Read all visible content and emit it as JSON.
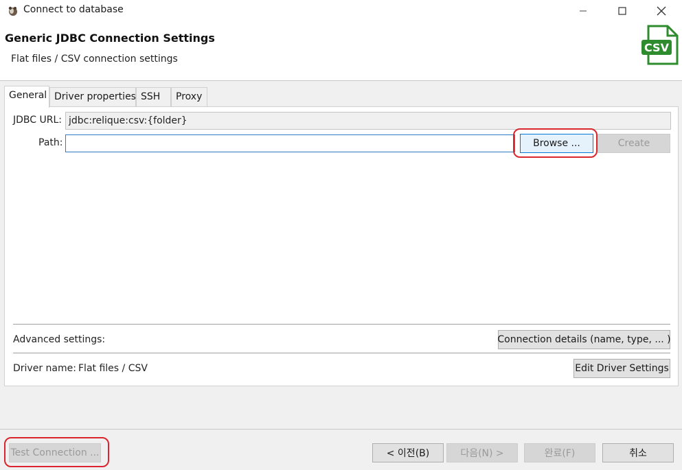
{
  "window": {
    "title": "Connect to database",
    "minimize_icon": "minimize-icon",
    "maximize_icon": "maximize-icon",
    "close_icon": "close-icon"
  },
  "header": {
    "title": "Generic JDBC Connection Settings",
    "subtitle": "Flat files / CSV connection settings",
    "badge_icon": "csv-file-icon",
    "badge_text": "CSV",
    "badge_color": "#2e8b2e"
  },
  "tabs": [
    {
      "label": "General",
      "active": true
    },
    {
      "label": "Driver properties",
      "active": false
    },
    {
      "label": "SSH",
      "active": false
    },
    {
      "label": "Proxy",
      "active": false
    }
  ],
  "general": {
    "jdbc_url_label": "JDBC URL:",
    "jdbc_url_value": "jdbc:relique:csv:{folder}",
    "path_label": "Path:",
    "path_value": "",
    "browse_button": "Browse ...",
    "create_button": "Create",
    "advanced_label": "Advanced settings:",
    "connection_details_button": "Connection details (name, type, ... )",
    "driver_name_label": "Driver name:",
    "driver_name_value": "Flat files / CSV",
    "edit_driver_button": "Edit Driver Settings"
  },
  "footer": {
    "test_connection": "Test Connection ...",
    "back": "< 이전(B)",
    "next": "다음(N) >",
    "finish": "완료(F)",
    "cancel": "취소"
  },
  "highlight_color": "#d9262c"
}
